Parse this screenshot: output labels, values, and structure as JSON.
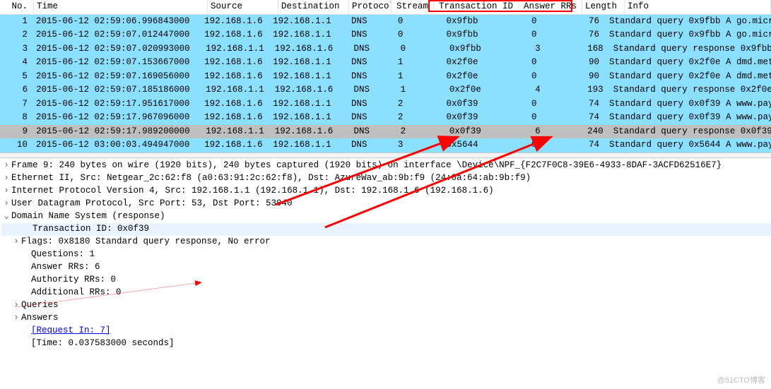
{
  "columns": {
    "no": "No.",
    "time": "Time",
    "source": "Source",
    "destination": "Destination",
    "protocol": "Protocol",
    "stream": "Stream",
    "transaction_id": "Transaction ID",
    "answer_rrs": "Answer RRs",
    "length": "Length",
    "info": "Info"
  },
  "packets": [
    {
      "no": "1",
      "time": "2015-06-12 02:59:06.996843000",
      "src": "192.168.1.6",
      "dst": "192.168.1.1",
      "proto": "DNS",
      "stream": "0",
      "tid": "0x9fbb",
      "arr": "0",
      "len": "76",
      "info": "Standard query 0x9fbb A go.micr"
    },
    {
      "no": "2",
      "time": "2015-06-12 02:59:07.012447000",
      "src": "192.168.1.6",
      "dst": "192.168.1.1",
      "proto": "DNS",
      "stream": "0",
      "tid": "0x9fbb",
      "arr": "0",
      "len": "76",
      "info": "Standard query 0x9fbb A go.micr"
    },
    {
      "no": "3",
      "time": "2015-06-12 02:59:07.020993000",
      "src": "192.168.1.1",
      "dst": "192.168.1.6",
      "proto": "DNS",
      "stream": "0",
      "tid": "0x9fbb",
      "arr": "3",
      "len": "168",
      "info": "Standard query response 0x9fbb"
    },
    {
      "no": "4",
      "time": "2015-06-12 02:59:07.153667000",
      "src": "192.168.1.6",
      "dst": "192.168.1.1",
      "proto": "DNS",
      "stream": "1",
      "tid": "0x2f0e",
      "arr": "0",
      "len": "90",
      "info": "Standard query 0x2f0e A dmd.met"
    },
    {
      "no": "5",
      "time": "2015-06-12 02:59:07.169056000",
      "src": "192.168.1.6",
      "dst": "192.168.1.1",
      "proto": "DNS",
      "stream": "1",
      "tid": "0x2f0e",
      "arr": "0",
      "len": "90",
      "info": "Standard query 0x2f0e A dmd.met"
    },
    {
      "no": "6",
      "time": "2015-06-12 02:59:07.185186000",
      "src": "192.168.1.1",
      "dst": "192.168.1.6",
      "proto": "DNS",
      "stream": "1",
      "tid": "0x2f0e",
      "arr": "4",
      "len": "193",
      "info": "Standard query response 0x2f0e"
    },
    {
      "no": "7",
      "time": "2015-06-12 02:59:17.951617000",
      "src": "192.168.1.6",
      "dst": "192.168.1.1",
      "proto": "DNS",
      "stream": "2",
      "tid": "0x0f39",
      "arr": "0",
      "len": "74",
      "info": "Standard query 0x0f39 A www.pay"
    },
    {
      "no": "8",
      "time": "2015-06-12 02:59:17.967096000",
      "src": "192.168.1.6",
      "dst": "192.168.1.1",
      "proto": "DNS",
      "stream": "2",
      "tid": "0x0f39",
      "arr": "0",
      "len": "74",
      "info": "Standard query 0x0f39 A www.pay"
    },
    {
      "no": "9",
      "time": "2015-06-12 02:59:17.989200000",
      "src": "192.168.1.1",
      "dst": "192.168.1.6",
      "proto": "DNS",
      "stream": "2",
      "tid": "0x0f39",
      "arr": "6",
      "len": "240",
      "info": "Standard query response 0x0f39",
      "selected": true
    },
    {
      "no": "10",
      "time": "2015-06-12 03:00:03.494947000",
      "src": "192.168.1.6",
      "dst": "192.168.1.1",
      "proto": "DNS",
      "stream": "3",
      "tid": "0x5644",
      "arr": "0",
      "len": "74",
      "info": "Standard query 0x5644 A www.pay"
    }
  ],
  "details": {
    "frame": "Frame 9: 240 bytes on wire (1920 bits), 240 bytes captured (1920 bits) on interface \\Device\\NPF_{F2C7F0C8-39E6-4933-8DAF-3ACFD62516E7}",
    "eth": "Ethernet II, Src: Netgear_2c:62:f8 (a0:63:91:2c:62:f8), Dst: AzureWav_ab:9b:f9 (24:0a:64:ab:9b:f9)",
    "ip": "Internet Protocol Version 4, Src: 192.168.1.1 (192.168.1.1), Dst: 192.168.1.6 (192.168.1.6)",
    "udp": "User Datagram Protocol, Src Port: 53, Dst Port: 53040",
    "dns": "Domain Name System (response)",
    "tid": "Transaction ID: 0x0f39",
    "flags": "Flags: 0x8180 Standard query response, No error",
    "questions": "Questions: 1",
    "answerrrs": "Answer RRs: 6",
    "authrrs": "Authority RRs: 0",
    "addrrs": "Additional RRs: 0",
    "queries": "Queries",
    "answers": "Answers",
    "reqin": "[Request In: 7]",
    "time": "[Time: 0.037583000 seconds]"
  },
  "watermark": "@51CTO博客"
}
